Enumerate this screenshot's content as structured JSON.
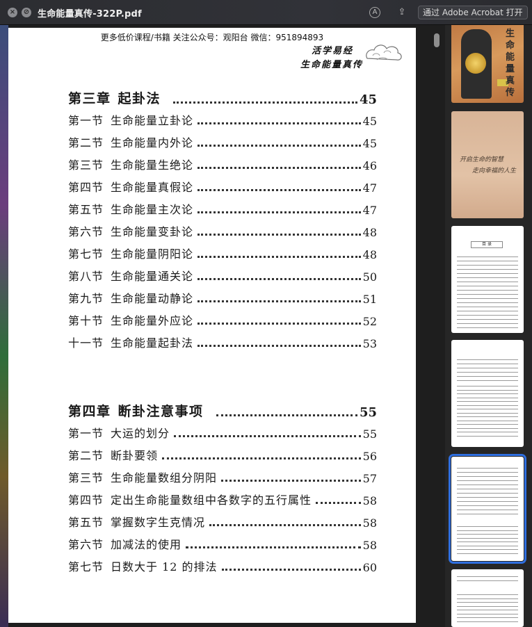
{
  "window": {
    "title": "生命能量真传-322P.pdf",
    "open_button": "通过 Adobe Acrobat 打开",
    "close_glyph": "×",
    "minimize_glyph": "⊘",
    "annotate_glyph": "A",
    "share_glyph": "⇪"
  },
  "page": {
    "header": "更多低价课程/书籍  关注公众号：观阳台   微信：951894893",
    "seal_line1": "活学易经",
    "seal_line2": "生命能量真传"
  },
  "toc": [
    {
      "kind": "chapter",
      "section": "第三章",
      "title": "起卦法",
      "page": "45"
    },
    {
      "kind": "section",
      "section": "第一节",
      "title": "生命能量立卦论",
      "page": "45"
    },
    {
      "kind": "section",
      "section": "第二节",
      "title": "生命能量内外论",
      "page": "45"
    },
    {
      "kind": "section",
      "section": "第三节",
      "title": "生命能量生绝论",
      "page": "46"
    },
    {
      "kind": "section",
      "section": "第四节",
      "title": "生命能量真假论",
      "page": "47"
    },
    {
      "kind": "section",
      "section": "第五节",
      "title": "生命能量主次论",
      "page": "47"
    },
    {
      "kind": "section",
      "section": "第六节",
      "title": "生命能量变卦论",
      "page": "48"
    },
    {
      "kind": "section",
      "section": "第七节",
      "title": "生命能量阴阳论",
      "page": "48"
    },
    {
      "kind": "section",
      "section": "第八节",
      "title": "生命能量通关论",
      "page": "50"
    },
    {
      "kind": "section",
      "section": "第九节",
      "title": "生命能量动静论",
      "page": "51"
    },
    {
      "kind": "section",
      "section": "第十节",
      "title": "生命能量外应论",
      "page": "52"
    },
    {
      "kind": "section",
      "section": "十一节",
      "title": "生命能量起卦法",
      "page": "53"
    },
    {
      "kind": "chapter",
      "section": "第四章",
      "title": "断卦注意事项",
      "page": "55"
    },
    {
      "kind": "section",
      "section": "第一节",
      "title": "大运的划分",
      "page": "55"
    },
    {
      "kind": "section",
      "section": "第二节",
      "title": "断卦要领",
      "page": "56"
    },
    {
      "kind": "section",
      "section": "第三节",
      "title": "生命能量数组分阴阳",
      "page": "57"
    },
    {
      "kind": "section",
      "section": "第四节",
      "title": "定出生命能量数组中各数字的五行属性",
      "page": "58"
    },
    {
      "kind": "section",
      "section": "第五节",
      "title": "掌握数字生克情况",
      "page": "58"
    },
    {
      "kind": "section",
      "section": "第六节",
      "title": "加减法的使用",
      "page": "58"
    },
    {
      "kind": "section",
      "section": "第七节",
      "title": "日数大于 12 的排法",
      "page": "60"
    }
  ],
  "thumbnails": {
    "cover_title": "生命能量真传",
    "cover2_line1": "开启生命的智慧",
    "cover2_line2": "走向幸福的人生",
    "toc_heading": "目 录"
  },
  "colors": {
    "selected_thumb": "#2f6fe0",
    "titlebar": "#2c2d31"
  }
}
